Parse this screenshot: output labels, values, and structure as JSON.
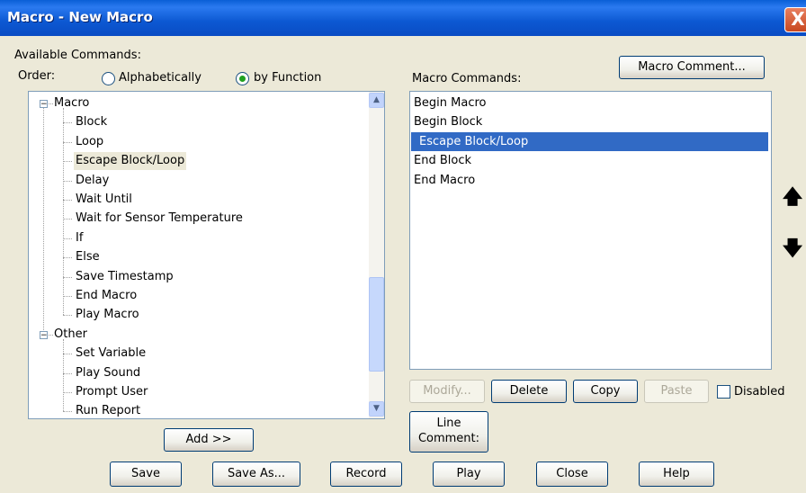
{
  "window": {
    "title": "Macro - New Macro",
    "close_glyph": "X"
  },
  "available": {
    "label": "Available Commands:",
    "order_label": "Order:",
    "order_options": [
      {
        "label": "Alphabetically",
        "selected": false
      },
      {
        "label": "by Function",
        "selected": true
      }
    ],
    "tree": [
      {
        "label": "Macro",
        "group": true,
        "expander": "−"
      },
      {
        "label": "Block"
      },
      {
        "label": "Loop"
      },
      {
        "label": "Escape Block/Loop",
        "selected": true
      },
      {
        "label": "Delay"
      },
      {
        "label": "Wait Until"
      },
      {
        "label": "Wait for Sensor Temperature"
      },
      {
        "label": "If"
      },
      {
        "label": "Else"
      },
      {
        "label": "Save Timestamp"
      },
      {
        "label": "End Macro"
      },
      {
        "label": "Play Macro"
      },
      {
        "label": "Other",
        "group": true,
        "expander": "−"
      },
      {
        "label": "Set Variable"
      },
      {
        "label": "Play Sound"
      },
      {
        "label": "Prompt User"
      },
      {
        "label": "Run Report"
      }
    ],
    "add_button": "Add >>"
  },
  "macro": {
    "label": "Macro Commands:",
    "comment_button": "Macro Comment...",
    "commands": [
      {
        "label": "Begin Macro"
      },
      {
        "label": "Begin Block"
      },
      {
        "label": "Escape Block/Loop",
        "selected": true
      },
      {
        "label": "End Block"
      },
      {
        "label": "End Macro"
      }
    ],
    "modify_button": "Modify...",
    "delete_button": "Delete",
    "copy_button": "Copy",
    "paste_button": "Paste",
    "disabled_label": "Disabled",
    "line_comment_line1": "Line",
    "line_comment_line2": "Comment:",
    "move_up_glyph": "🡅",
    "move_down_glyph": "🡇"
  },
  "footer": {
    "save": "Save",
    "save_as": "Save As...",
    "record": "Record",
    "play": "Play",
    "close": "Close",
    "help": "Help"
  }
}
